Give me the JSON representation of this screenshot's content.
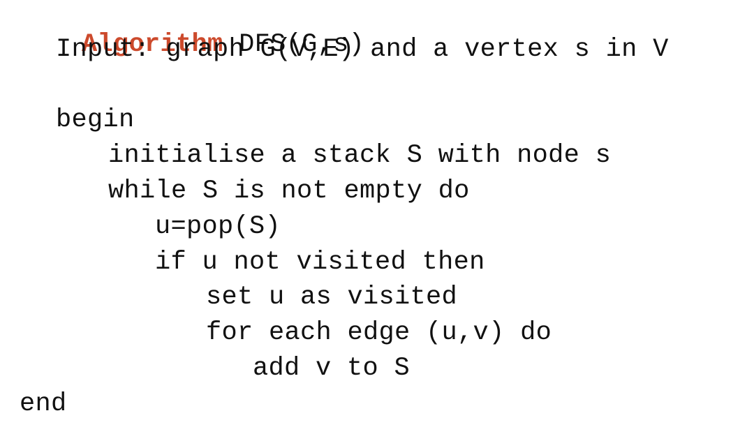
{
  "algorithm": {
    "keyword": "Algorithm",
    "signature": "DFS(G,s)",
    "input": "Input: graph G(V,E) and a vertex s in V",
    "lines": [
      "begin",
      "initialise a stack S with node s",
      "while S is not empty do",
      "u=pop(S)",
      "if u not visited then",
      "set u as visited",
      "for each edge (u,v) do",
      "add v to S",
      "end"
    ]
  },
  "colors": {
    "keyword": "#cc4a2c",
    "text": "#111111",
    "background": "#ffffff"
  }
}
